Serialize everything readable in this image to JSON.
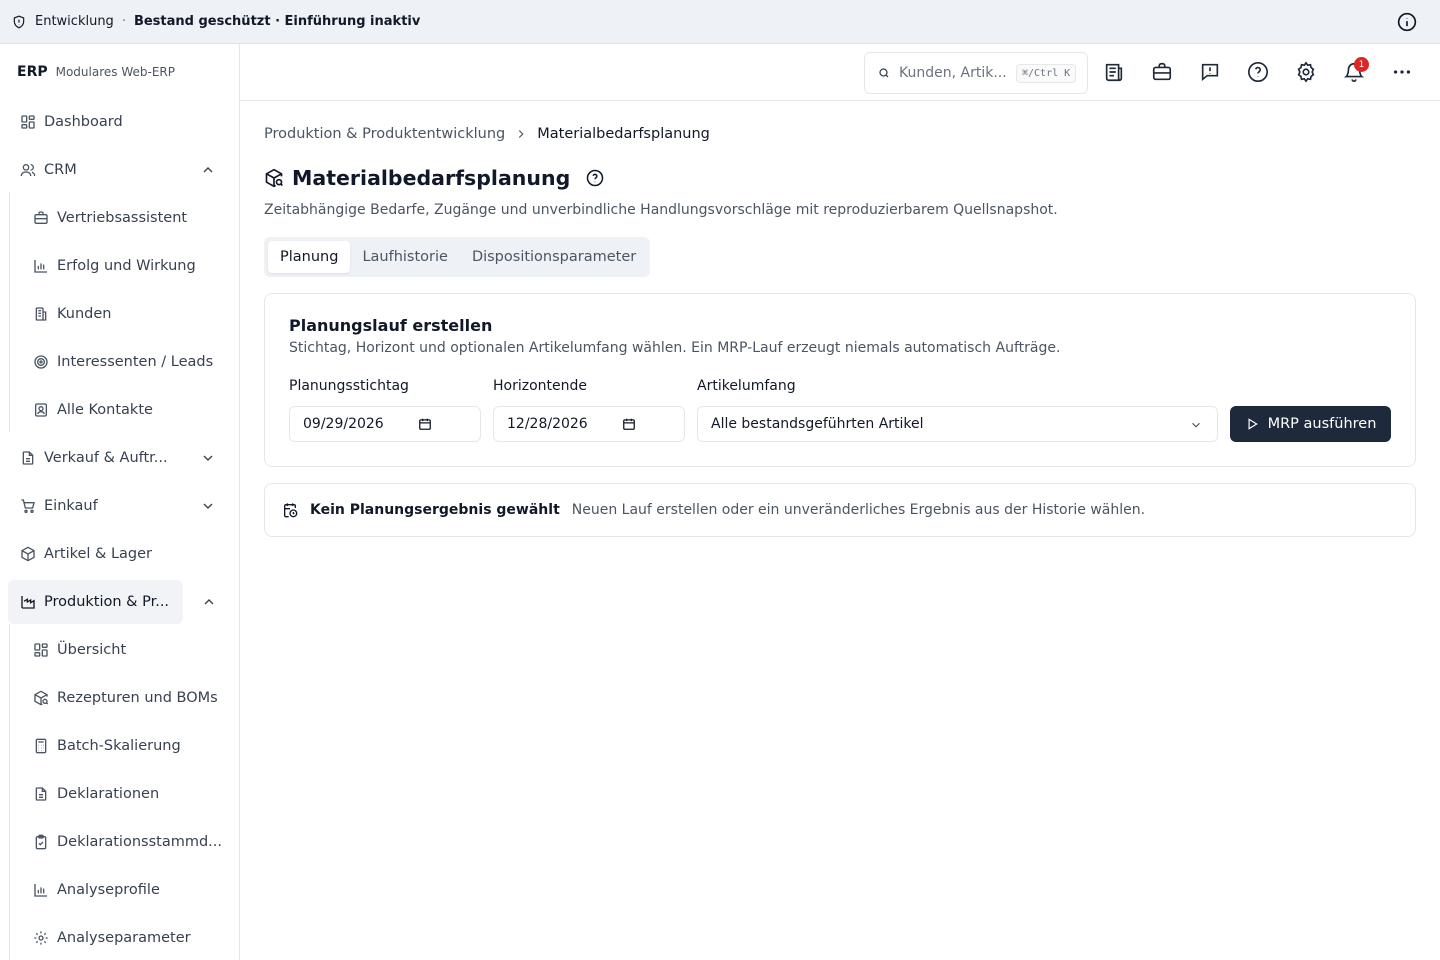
{
  "banner": {
    "environment": "Entwicklung",
    "separator": "·",
    "status": "Bestand geschützt · Einführung inaktiv"
  },
  "brand": {
    "logo": "ERP",
    "tagline": "Modulares Web-ERP"
  },
  "sidebar": {
    "dashboard": "Dashboard",
    "crm": {
      "label": "CRM",
      "items": [
        "Vertriebsassistent",
        "Erfolg und Wirkung",
        "Kunden",
        "Interessenten / Leads",
        "Alle Kontakte"
      ]
    },
    "sales": "Verkauf & Auftr...",
    "purchasing": "Einkauf",
    "inventory": "Artikel & Lager",
    "production": {
      "label": "Produktion & Pr...",
      "items": [
        "Übersicht",
        "Rezepturen und BOMs",
        "Batch-Skalierung",
        "Deklarationen",
        "Deklarationsstammd...",
        "Analyseprofile",
        "Analyseparameter"
      ]
    }
  },
  "header": {
    "search_placeholder": "Kunden, Artik...",
    "search_shortcut": "⌘/Ctrl K",
    "notification_count": "1",
    "icons": [
      "news-icon",
      "briefcase-icon",
      "feedback-icon",
      "help-icon",
      "settings-icon",
      "bell-icon",
      "more-icon"
    ]
  },
  "breadcrumb": {
    "parent": "Produktion & Produktentwicklung",
    "current": "Materialbedarfsplanung"
  },
  "page": {
    "title": "Materialbedarfsplanung",
    "subtitle": "Zeitabhängige Bedarfe, Zugänge und unverbindliche Handlungsvorschläge mit reproduzierbarem Quellsnapshot."
  },
  "tabs": [
    {
      "label": "Planung",
      "active": true
    },
    {
      "label": "Laufhistorie",
      "active": false
    },
    {
      "label": "Dispositionsparameter",
      "active": false
    }
  ],
  "planning_card": {
    "title": "Planungslauf erstellen",
    "description": "Stichtag, Horizont und optionalen Artikelumfang wählen. Ein MRP-Lauf erzeugt niemals automatisch Aufträge.",
    "planning_date_label": "Planungsstichtag",
    "planning_date_value": "09/29/2026",
    "horizon_label": "Horizontende",
    "horizon_value": "12/28/2026",
    "scope_label": "Artikelumfang",
    "scope_value": "Alle bestandsgeführten Artikel",
    "run_button": "MRP ausführen"
  },
  "empty_state": {
    "title": "Kein Planungsergebnis gewählt",
    "message": "Neuen Lauf erstellen oder ein unveränderliches Ergebnis aus der Historie wählen."
  },
  "colors": {
    "primary_button": "#1e293b",
    "banner_bg": "#eef2f7",
    "badge": "#dc2626",
    "muted_text": "#4b5563"
  }
}
